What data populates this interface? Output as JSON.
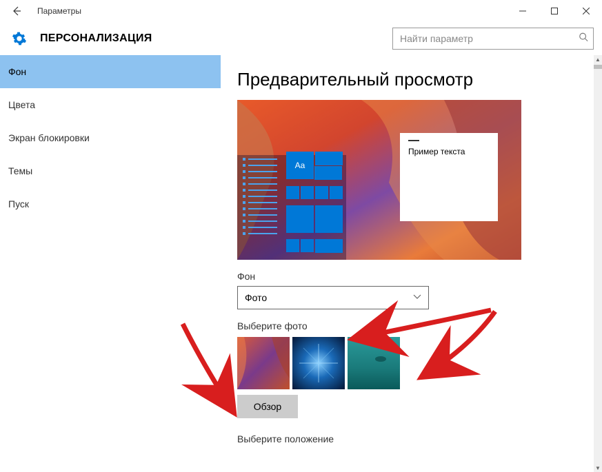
{
  "titlebar": {
    "title": "Параметры"
  },
  "header": {
    "section": "ПЕРСОНАЛИЗАЦИЯ",
    "search_placeholder": "Найти параметр"
  },
  "sidebar": {
    "items": [
      {
        "label": "Фон",
        "active": true
      },
      {
        "label": "Цвета",
        "active": false
      },
      {
        "label": "Экран блокировки",
        "active": false
      },
      {
        "label": "Темы",
        "active": false
      },
      {
        "label": "Пуск",
        "active": false
      }
    ]
  },
  "content": {
    "heading": "Предварительный просмотр",
    "preview_sample_text": "Пример текста",
    "preview_tile_text": "Aa",
    "bg_label": "Фон",
    "bg_dropdown_value": "Фото",
    "choose_photo_label": "Выберите фото",
    "browse_button": "Обзор",
    "choose_position_label": "Выберите положение"
  }
}
